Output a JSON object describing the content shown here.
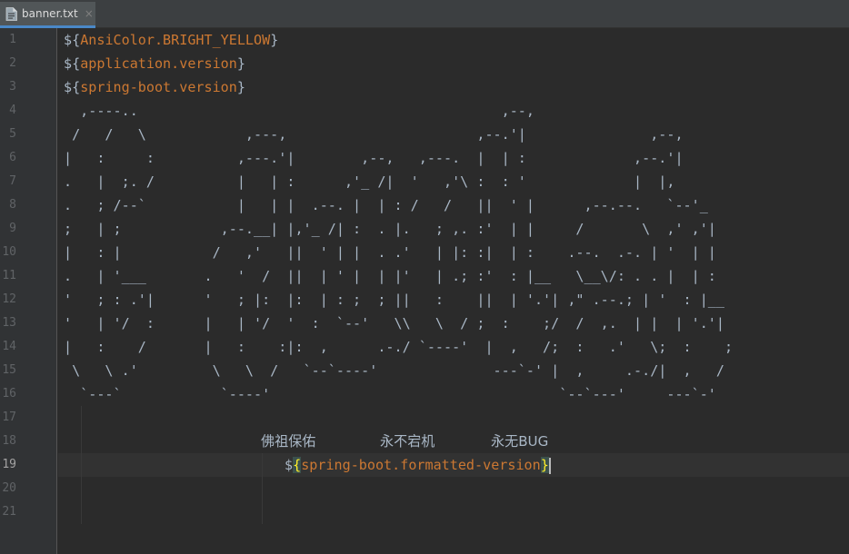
{
  "tab": {
    "filename": "banner.txt",
    "close": "×"
  },
  "line_numbers": [
    "1",
    "2",
    "3",
    "4",
    "5",
    "6",
    "7",
    "8",
    "9",
    "10",
    "11",
    "12",
    "13",
    "14",
    "15",
    "16",
    "17",
    "18",
    "19",
    "20",
    "21"
  ],
  "lines": {
    "l1": {
      "open": "${",
      "prop": "AnsiColor.BRIGHT_YELLOW",
      "close": "}"
    },
    "l2": {
      "open": "${",
      "prop": "application.version",
      "close": "}"
    },
    "l3": {
      "open": "${",
      "prop": "spring-boot.version",
      "close": "}"
    },
    "ascii": [
      "  ,----..                                            ,--,",
      " /   /   \\            ,---,                       ,--.'|               ,--,",
      "|   :     :          ,---.'|        ,--,   ,---.  |  | :             ,--.'|",
      ".   |  ;. /          |   | :      ,'_ /|  '   ,'\\ :  : '             |  |,",
      ".   ; /--`           |   | |  .--. |  | : /   /   ||  ' |      ,--.--.   `--'_",
      ";   | ;            ,--.__| |,'_ /| :  . |.   ; ,. :'  | |     /       \\  ,' ,'|",
      "|   : |           /   ,'   ||  ' | |  . .'   | |: :|  | :    .--.  .-. | '  | |",
      ".   | '___       .   '  /  ||  | ' |  | |'   | .; :'  : |__   \\__\\/: . . |  | :",
      "'   ; : .'|      '   ; |:  |:  | : ;  ; ||   :    ||  | '.'| ,\" .--.; | '  : |__",
      "'   | '/  :      |   | '/  '  :  `--'   \\\\   \\  / ;  :    ;/  /  ,.  | |  | '.'|",
      "|   :    /       |   :    :|:  ,      .-./ `----'  |  ,   /;  :   .'   \\;  :    ;",
      " \\   \\ .'         \\   \\  /   `--`----'              ---`-' |  ,     .-./|  ,   /",
      "  `---`            `----'                                   `--`---'     ---`-'"
    ],
    "l18": {
      "a": "佛祖保佑",
      "b": "永不宕机",
      "c": "永无BUG"
    },
    "l19": {
      "open_dollar": "$",
      "open_brace": "{",
      "prop": "spring-boot.formatted-version",
      "close_brace": "}"
    }
  }
}
